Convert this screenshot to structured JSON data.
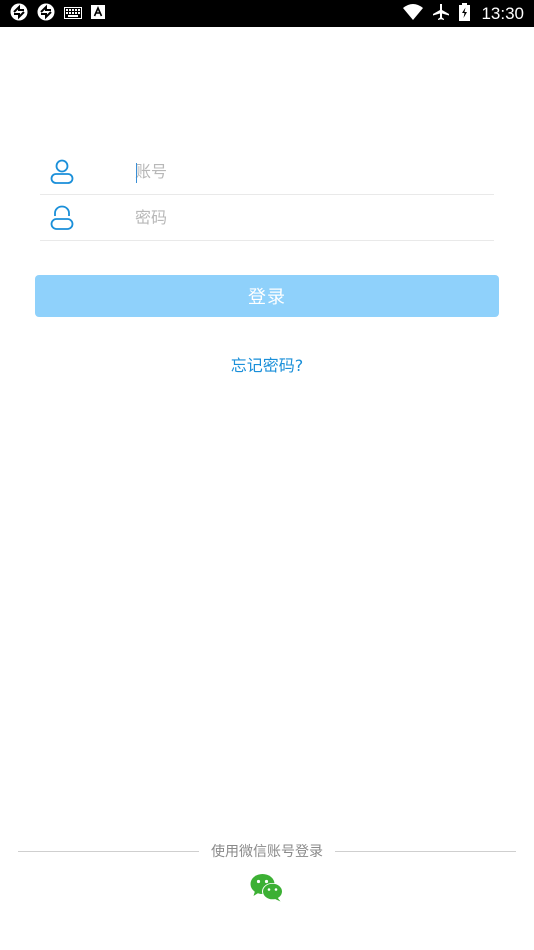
{
  "status_bar": {
    "time": "13:30"
  },
  "login_form": {
    "account_placeholder": "账号",
    "password_placeholder": "密码",
    "login_label": "登录",
    "forgot_label": "忘记密码?"
  },
  "third_party": {
    "divider_label": "使用微信账号登录",
    "wechat_icon": "wechat-icon"
  },
  "colors": {
    "accent": "#1a8fd9",
    "button_disabled": "#8fd1fb",
    "wechat_green": "#3cb034",
    "divider": "#cfcfcf"
  }
}
